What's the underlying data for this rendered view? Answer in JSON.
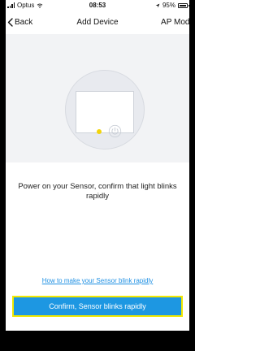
{
  "status_bar": {
    "carrier": "Optus",
    "time": "08:53",
    "battery_text": "95%",
    "signal_icon": "signal-bars-icon",
    "wifi_icon": "wifi-icon",
    "location_icon": "location-arrow-icon",
    "battery_icon": "battery-icon"
  },
  "nav": {
    "back_label": "Back",
    "back_icon": "chevron-left-icon",
    "title": "Add Device",
    "right_label": "AP Mode"
  },
  "illustration": {
    "indicator_color": "#f2d40b",
    "power_icon": "power-icon"
  },
  "instruction_text": "Power on your Sensor, confirm that light blinks rapidly",
  "help_link_text": "How to make your Sensor blink rapidly",
  "confirm_button_label": "Confirm, Sensor blinks rapidly",
  "colors": {
    "accent": "#1d97e2",
    "link": "#1d8fe3",
    "highlight": "#f2e800"
  }
}
